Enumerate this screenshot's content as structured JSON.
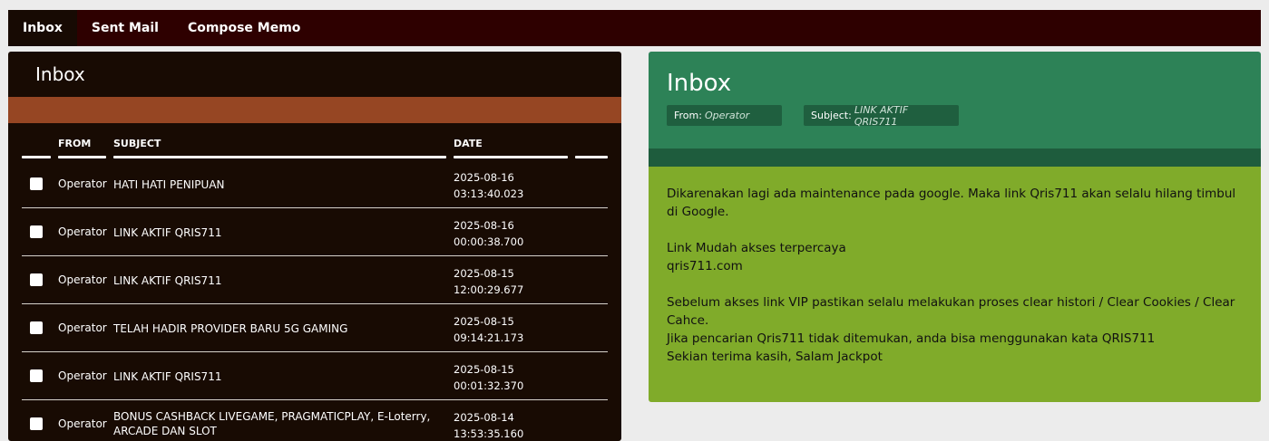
{
  "nav": {
    "tabs": [
      "Inbox",
      "Sent Mail",
      "Compose Memo"
    ]
  },
  "inbox_panel": {
    "title": "Inbox",
    "columns": {
      "from": "FROM",
      "subject": "SUBJECT",
      "date": "DATE"
    },
    "rows": [
      {
        "from": "Operator",
        "subject": "HATI HATI PENIPUAN",
        "date": "2025-08-16",
        "time": "03:13:40.023"
      },
      {
        "from": "Operator",
        "subject": "LINK AKTIF QRIS711",
        "date": "2025-08-16",
        "time": "00:00:38.700"
      },
      {
        "from": "Operator",
        "subject": "LINK AKTIF QRIS711",
        "date": "2025-08-15",
        "time": "12:00:29.677"
      },
      {
        "from": "Operator",
        "subject": "TELAH HADIR PROVIDER BARU 5G GAMING",
        "date": "2025-08-15",
        "time": "09:14:21.173"
      },
      {
        "from": "Operator",
        "subject": "LINK AKTIF QRIS711",
        "date": "2025-08-15",
        "time": "00:01:32.370"
      },
      {
        "from": "Operator",
        "subject": "BONUS CASHBACK LIVEGAME, PRAGMATICPLAY, E-Loterry, ARCADE DAN SLOT",
        "date": "2025-08-14",
        "time": "13:53:35.160"
      }
    ]
  },
  "message_panel": {
    "title": "Inbox",
    "from_label": "From:",
    "from_value": "Operator",
    "subject_label": "Subject:",
    "subject_value": "LINK AKTIF QRIS711",
    "body": {
      "p1": "Dikarenakan lagi ada maintenance pada google. Maka link Qris711 akan selalu hilang timbul di Google.",
      "p2a": "Link Mudah akses terpercaya",
      "p2b": "qris711.com",
      "p3a": "Sebelum akses link VIP pastikan selalu melakukan proses clear histori / Clear Cookies / Clear Cahce.",
      "p3b": "Jika pencarian Qris711 tidak ditemukan, anda bisa menggunakan kata QRIS711",
      "p3c": "Sekian terima kasih, Salam Jackpot"
    }
  },
  "colors": {
    "nav_bg": "#2e0000",
    "panel_bg": "#180b03",
    "accent_orange": "#964623",
    "header_green": "#2d8257",
    "body_green": "#80ab2a"
  }
}
